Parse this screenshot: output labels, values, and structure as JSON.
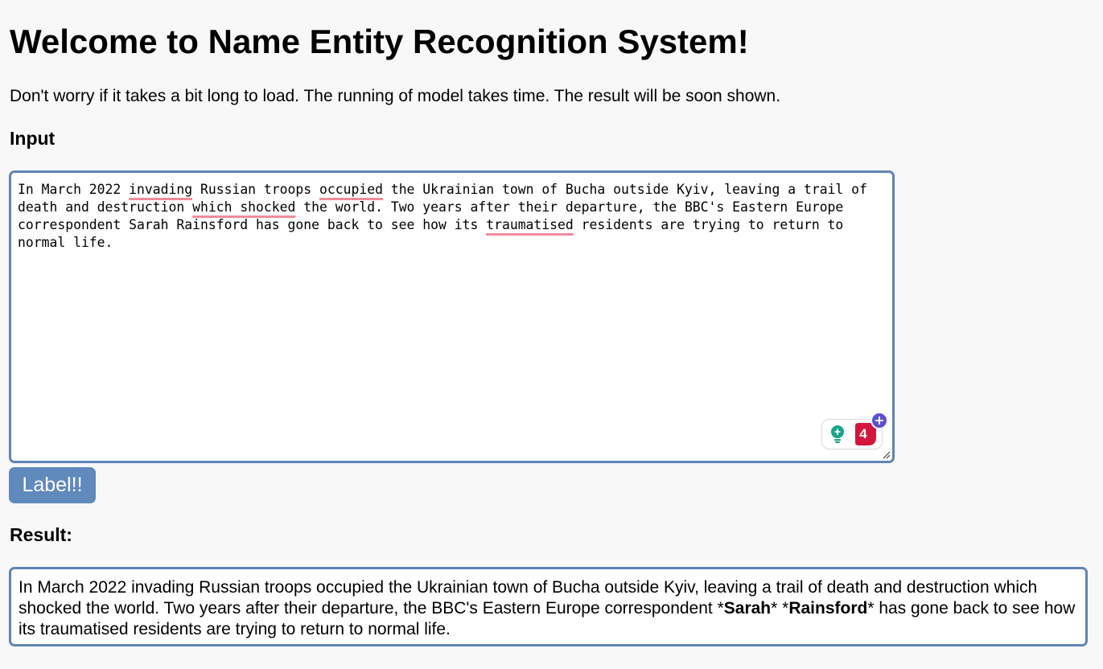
{
  "header": {
    "title": "Welcome to Name Entity Recognition System!",
    "notice": "Don't worry if it takes a bit long to load. The running of model takes time. The result will be soon shown."
  },
  "input": {
    "heading": "Input",
    "segments": [
      {
        "text": "In March 2022 ",
        "flag": false
      },
      {
        "text": "invading",
        "flag": true
      },
      {
        "text": " Russian troops ",
        "flag": false
      },
      {
        "text": "occupied",
        "flag": true
      },
      {
        "text": " the Ukrainian town of Bucha outside Kyiv, leaving a trail of death and destruction ",
        "flag": false
      },
      {
        "text": "which shocked",
        "flag": true
      },
      {
        "text": " the world. Two years after their departure, the BBC's Eastern Europe correspondent Sarah Rainsford has gone back to see how its ",
        "flag": false
      },
      {
        "text": "traumatised",
        "flag": true
      },
      {
        "text": " residents are trying to return to normal life.",
        "flag": false
      }
    ],
    "extension": {
      "icon": "lightbulb-icon",
      "count": "4",
      "plus": "+",
      "colors": {
        "bulb": "#15a589",
        "badge": "#d4163c",
        "plus": "#5b4fd1"
      }
    }
  },
  "button": {
    "label": "Label!!"
  },
  "result": {
    "heading": "Result:",
    "part1": "In March 2022 invading Russian troops occupied the Ukrainian town of Bucha outside Kyiv, leaving a trail of death and destruction which shocked the world. Two years after their departure, the BBC's Eastern Europe correspondent *",
    "entity1": "Sarah",
    "part2": "* *",
    "entity2": "Rainsford",
    "part3": "* has gone back to see how its traumatised residents are trying to return to normal life."
  },
  "colors": {
    "accent": "#6089bc",
    "border": "#5f84b6",
    "background": "#f8f8f8",
    "spellcheck": "#f28b9c"
  }
}
